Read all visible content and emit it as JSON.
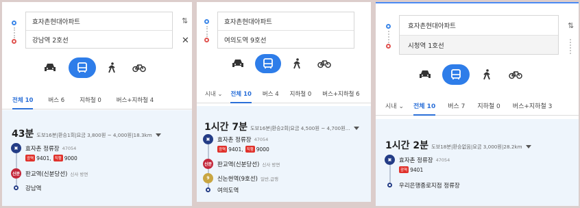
{
  "panels": [
    {
      "origin": "효자촌현대아파트",
      "destination": "강남역 2호선",
      "tabs": [
        "전체 10",
        "버스 6",
        "지하철 0",
        "버스+지하철 4"
      ],
      "summary": {
        "time": "43분",
        "walk": "도보16분",
        "transfer": "환승1회",
        "fare": "요금 3,800원 ~ 4,000원",
        "distance": "18.3km"
      },
      "stops": [
        {
          "icon": "bus",
          "name": "효자촌 정류장",
          "sub": "47054"
        },
        {
          "icon": "sinbundang",
          "label": "신분",
          "name": "판교역(신분당선)",
          "sub": "신사 방면"
        }
      ],
      "routes": [
        {
          "badge": "광역",
          "no": "9401,"
        },
        {
          "badge": "직행",
          "no": "9000"
        }
      ],
      "end": "강남역"
    },
    {
      "origin": "효자촌현대아파트",
      "destination": "여의도역 9호선",
      "tabs": [
        "시내",
        "전체 10",
        "버스 4",
        "지하철 0",
        "버스+지하철 6"
      ],
      "summary": {
        "time": "1시간 7분",
        "walk": "도보16분",
        "transfer": "환승2회",
        "fare": "요금 4,500원 ~ 4,700원...",
        "distance": ""
      },
      "stops": [
        {
          "icon": "bus",
          "name": "효자촌 정류장",
          "sub": "47054"
        },
        {
          "icon": "sinbundang",
          "label": "신분",
          "name": "판교역(신분당선)",
          "sub": "신사 방면"
        },
        {
          "icon": "line9",
          "label": "9",
          "name": "신논현역(9호선)",
          "sub": "일반,급행"
        }
      ],
      "routes": [
        {
          "badge": "광역",
          "no": "9401,"
        },
        {
          "badge": "직행",
          "no": "9000"
        }
      ],
      "end": "여의도역"
    },
    {
      "origin": "효자촌현대아파트",
      "destination": "시청역 1호선",
      "tabs": [
        "시내",
        "전체 10",
        "버스 7",
        "지하철 0",
        "버스+지하철 3"
      ],
      "summary": {
        "time": "1시간 2분",
        "walk": "도보18분",
        "transfer": "환승없음",
        "fare": "요금 3,000원",
        "distance": "28.2km"
      },
      "stops": [
        {
          "icon": "bus",
          "name": "효자촌 정류장",
          "sub": "47054"
        }
      ],
      "routes": [
        {
          "badge": "광역",
          "no": "9401"
        }
      ],
      "end": "우리은행종로지점 정류장"
    }
  ],
  "colors": {
    "accent": "#2e7de9",
    "bus": "#233c86",
    "sinbundang": "#c3273b",
    "line9": "#c9a642",
    "badge": "#e0312b",
    "result_bg": "#eef5fc"
  }
}
